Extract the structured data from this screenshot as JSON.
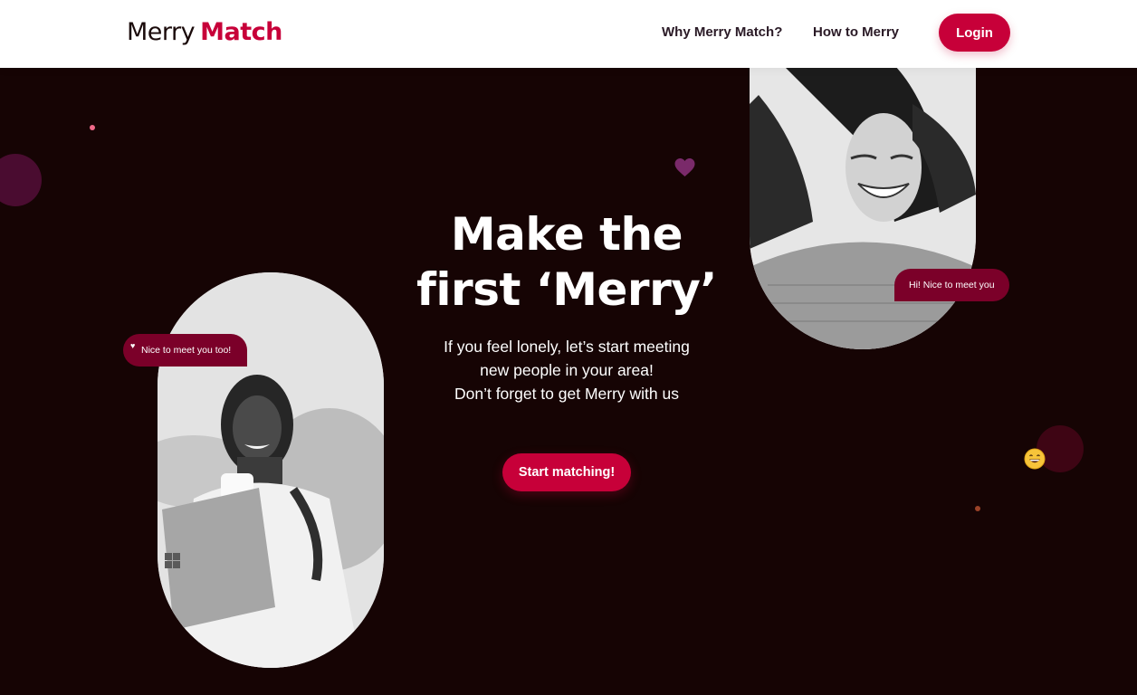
{
  "navbar": {
    "logo_first": "Merry",
    "logo_second": "Match",
    "links": [
      "Why Merry Match?",
      "How to Merry"
    ],
    "login_label": "Login"
  },
  "hero": {
    "headline_line1": "Make the",
    "headline_line2": "first ‘Merry’",
    "subtext_line1": "If you feel lonely, let’s start meeting",
    "subtext_line2": "new people in your area!",
    "subtext_line3": "Don’t forget to get Merry with us",
    "cta_label": "Start matching!"
  },
  "bubbles": {
    "left_text": "Nice to meet you too!",
    "right_text": "Hi! Nice to meet you"
  },
  "colors": {
    "brand": "#c70039",
    "background": "#160404",
    "bubble": "#7b0029"
  },
  "icons": [
    "heart-icon",
    "smiling-face-icon"
  ]
}
